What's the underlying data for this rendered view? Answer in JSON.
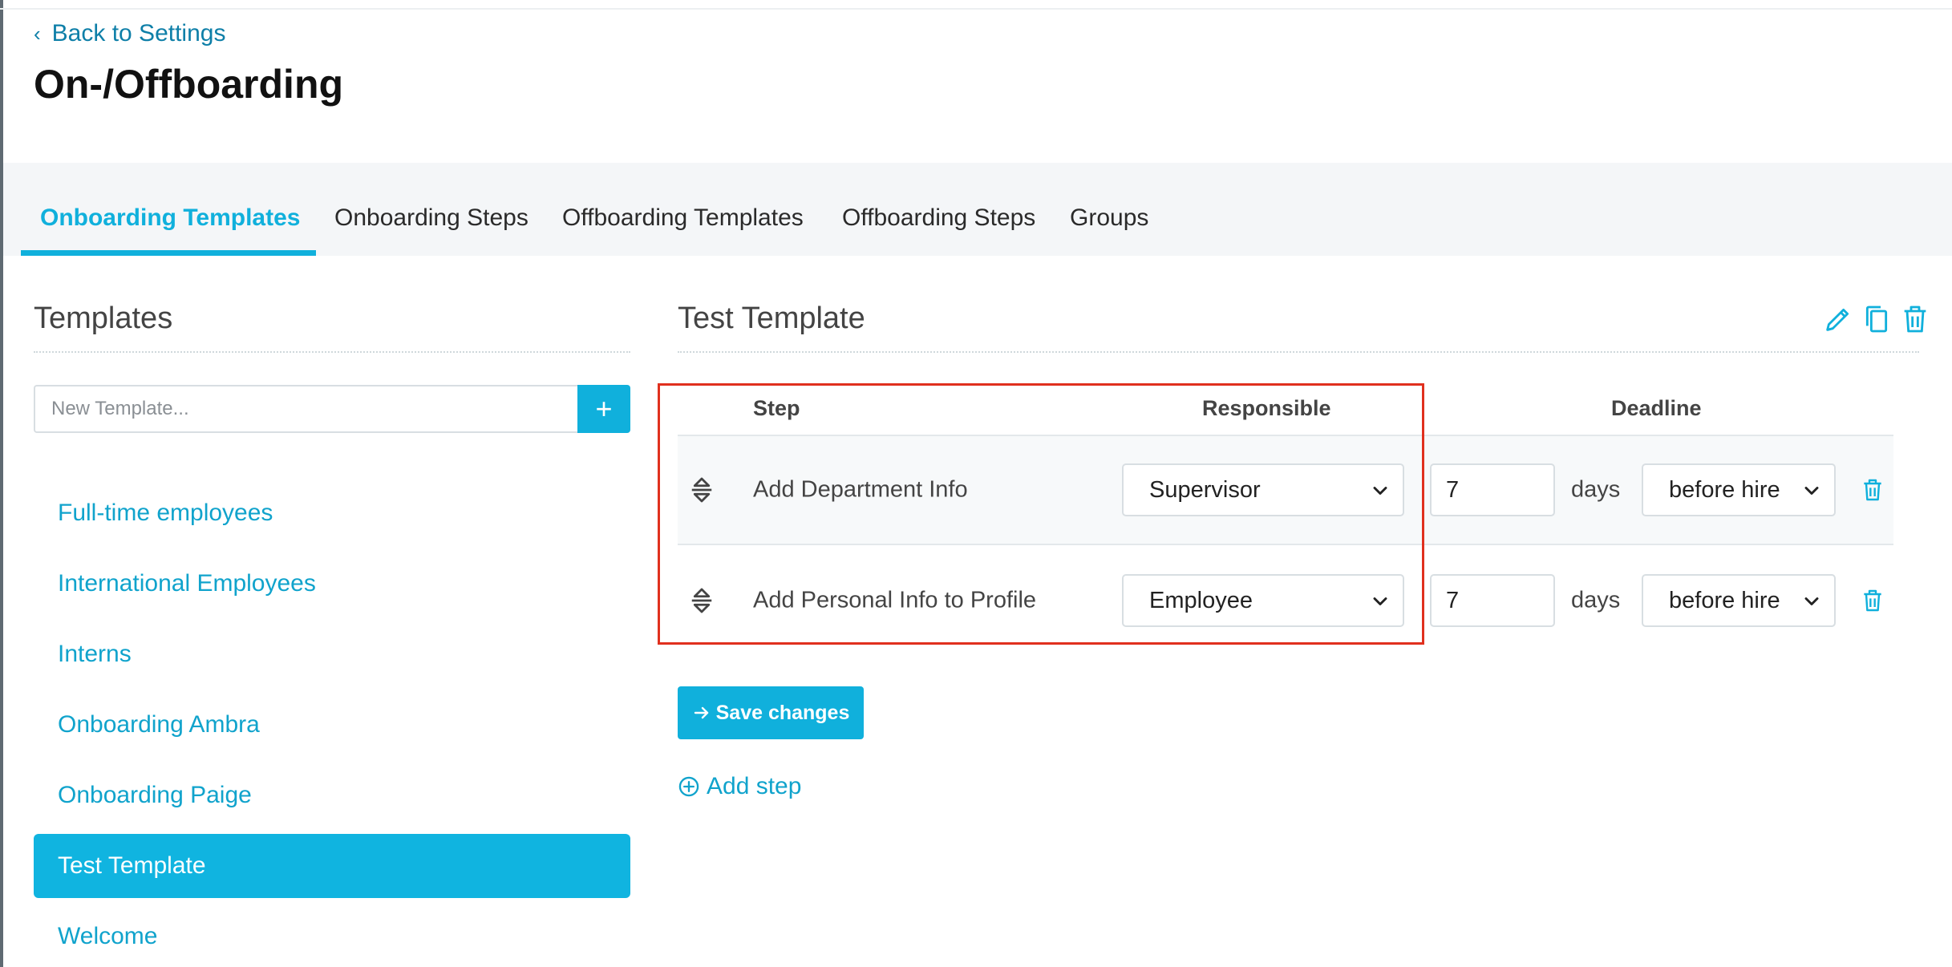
{
  "header": {
    "back_label": "Back to Settings",
    "page_title": "On-/Offboarding"
  },
  "tabs": [
    {
      "label": "Onboarding Templates",
      "active": true
    },
    {
      "label": "Onboarding Steps",
      "active": false
    },
    {
      "label": "Offboarding Templates",
      "active": false
    },
    {
      "label": "Offboarding Steps",
      "active": false
    },
    {
      "label": "Groups",
      "active": false
    }
  ],
  "sidebar": {
    "title": "Templates",
    "new_template_placeholder": "New Template...",
    "add_button_label": "+",
    "templates": [
      {
        "label": "Full-time employees",
        "selected": false
      },
      {
        "label": "International Employees",
        "selected": false
      },
      {
        "label": "Interns",
        "selected": false
      },
      {
        "label": "Onboarding Ambra",
        "selected": false
      },
      {
        "label": "Onboarding Paige",
        "selected": false
      },
      {
        "label": "Test Template",
        "selected": true
      },
      {
        "label": "Welcome",
        "selected": false
      }
    ]
  },
  "main": {
    "title": "Test Template",
    "header_icons": [
      "pencil-icon",
      "copy-icon",
      "trash-icon"
    ],
    "columns": {
      "step": "Step",
      "responsible": "Responsible",
      "deadline": "Deadline"
    },
    "steps": [
      {
        "name": "Add Department Info",
        "responsible": "Supervisor",
        "days_value": "7",
        "days_label": "days",
        "timing": "before hire"
      },
      {
        "name": "Add Personal Info to Profile",
        "responsible": "Employee",
        "days_value": "7",
        "days_label": "days",
        "timing": "before hire"
      }
    ],
    "save_label": "Save changes",
    "add_step_label": "Add step"
  },
  "colors": {
    "accent": "#10b0dc",
    "link": "#10a3cc",
    "highlight_border": "#e0301e"
  }
}
